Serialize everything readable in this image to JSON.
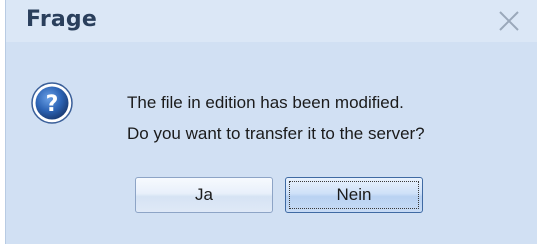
{
  "dialog": {
    "title": "Frage",
    "close_icon": "close-icon",
    "question_icon": "question-icon",
    "message_line1": "The file in edition has been modified.",
    "message_line2": "Do you want to transfer it to the server?",
    "buttons": {
      "yes_label": "Ja",
      "no_label": "Nein"
    },
    "focused_button": "Nein"
  },
  "colors": {
    "dialog_background": "#d1e0f3",
    "title_text": "#2a3f5c",
    "icon_blue": "#2d64b5"
  }
}
